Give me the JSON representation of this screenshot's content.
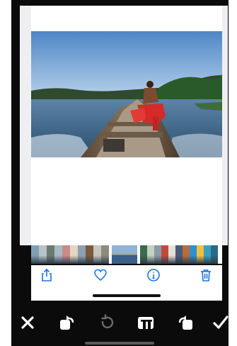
{
  "photo": {
    "description_icon": "boat-photo"
  },
  "filmstrip": {
    "left_colors": [
      "#7f9fb4",
      "#b9c2c8",
      "#6b7b70",
      "#a7b9c7",
      "#c98b88",
      "#e3d6c2",
      "#90a0b0",
      "#7c5a3f",
      "#c7c6be",
      "#8e8a7e"
    ],
    "right_colors": [
      "#3b6b4b",
      "#c2d2c0",
      "#8c9aa8",
      "#c04a3a",
      "#e6e1d7",
      "#4a5a7a",
      "#b56d3a",
      "#2e8fd1",
      "#f0c040",
      "#3aa0c0",
      "#2a6a8a"
    ]
  },
  "actions": {
    "share": "share-icon",
    "favorite": "heart-icon",
    "info": "info-icon",
    "delete": "trash-icon",
    "accent": "#1a73e8"
  },
  "toolbar": {
    "cancel": "close-icon",
    "rotate_left": "rotate-left-icon",
    "reset": "reset-icon",
    "aspect": "aspect-ratio-icon",
    "rotate_right": "rotate-right-icon",
    "confirm": "checkmark-icon"
  }
}
